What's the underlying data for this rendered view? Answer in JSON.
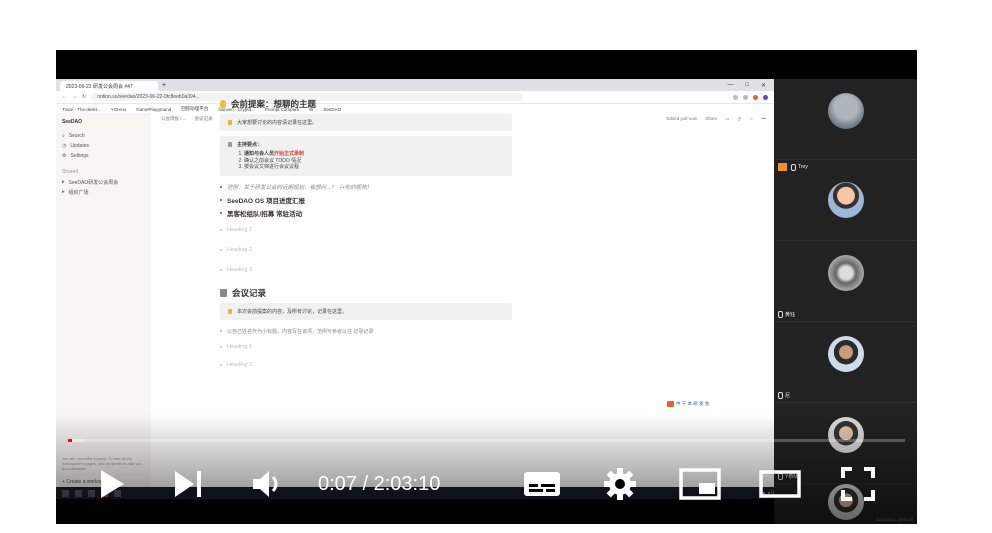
{
  "browser": {
    "tab_title": "2023-06-22 研发公会周会 #47",
    "url": "notion.so/seedao/2023-06-22-0fc8eeb0a394...",
    "bookmarks": [
      "Trace - The deskt...",
      "YOHHo",
      "GamePlayground",
      "回程助理平台",
      "Nansen - Crypto...",
      "Prompt Compare",
      "W",
      "SeeDAO"
    ]
  },
  "sidebar": {
    "workspace": "SeeDAO",
    "items": [
      "Search",
      "Updates",
      "Settings"
    ],
    "section": "Shared",
    "pages": [
      "SeeDAO研发公会周会",
      "组织广场"
    ],
    "note": "You are currently a guest. To see all the workspace's pages, ask an admin to add you as a member.",
    "create": "Create a workspace"
  },
  "crumb": {
    "parts": [
      "公会周报 / ...",
      "会议记录",
      "2023-06-22 研发公会周会 #47"
    ],
    "right": [
      "Edited just now",
      "Share"
    ]
  },
  "doc": {
    "h_proposal": "会前提案：想聊的主题",
    "callout1": "大家想要讨论的内容请记录在这里。",
    "callout2_title": "主持要点：",
    "callout2_items": [
      "通知与会人员开始正式录制",
      "确认之前会议 TODO 情况",
      "按会议文档进行会议议程"
    ],
    "callout2_red": "开始正式录制",
    "bullet_italic": "范例：关于研发公会的近期规划，我想问...？（+你的昵称）",
    "bullet_os": "SeeDAO OS 项目进度汇报",
    "bullet_hackathon": "黑客松组队/招募 常驻活动",
    "headings": [
      "Heading 1",
      "Heading 2",
      "Heading 3"
    ],
    "h_minutes": "会议记录",
    "callout3": "本次会前提案的内容，及所有讨论，记录在这里。",
    "bullet_last": "以自己姓名作为小标题，内容写在该项，范例可参考以往 记录记录",
    "headings2": [
      "Heading 1",
      "Heading 2"
    ],
    "logo_text": "中 宁 本 研 发 会"
  },
  "participants": [
    {
      "name": "",
      "avatar": "cat"
    },
    {
      "name": "Trey",
      "avatar": "person",
      "speaking": true
    },
    {
      "name": "黄钰",
      "avatar": "person"
    },
    {
      "name": "尼",
      "avatar": "person"
    },
    {
      "name": "Y恭M",
      "avatar": "person"
    },
    {
      "name": "",
      "avatar": "person"
    }
  ],
  "stamp": "2023/06/22 20:01:08",
  "player": {
    "current_time": "0:07",
    "duration": "2:03:10",
    "time_display": "0:07 / 2:03:10",
    "progress_fraction": 0.0001,
    "icons": [
      "play-icon",
      "next-icon",
      "volume-icon",
      "subtitles-icon",
      "settings-gear-icon",
      "miniplayer-icon",
      "theater-mode-icon",
      "fullscreen-icon"
    ]
  }
}
